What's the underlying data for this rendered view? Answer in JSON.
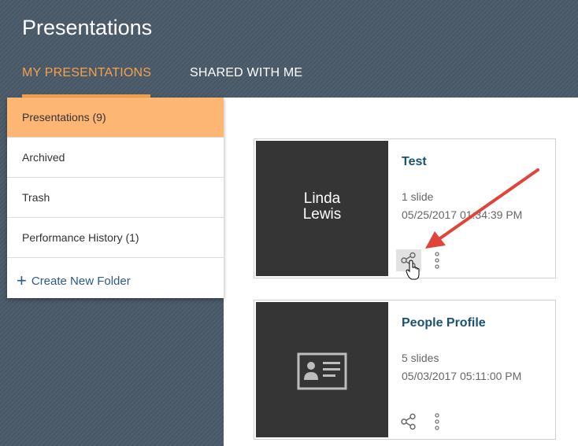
{
  "header": {
    "title": "Presentations"
  },
  "tabs": [
    {
      "label": "MY PRESENTATIONS",
      "active": true
    },
    {
      "label": "SHARED WITH ME",
      "active": false
    }
  ],
  "sidebar": {
    "items": [
      {
        "label": "Presentations (9)",
        "active": true
      },
      {
        "label": "Archived"
      },
      {
        "label": "Trash"
      },
      {
        "label": "Performance History (1)"
      }
    ],
    "create_folder": {
      "icon": "+",
      "label": "Create New Folder"
    }
  },
  "cards": [
    {
      "thumbnail_text_line1": "Linda",
      "thumbnail_text_line2": "Lewis",
      "title": "Test",
      "slides": "1 slide",
      "date": "05/25/2017 01:34:39 PM"
    },
    {
      "thumbnail_icon": "id-card-icon",
      "title": "People Profile",
      "slides": "5 slides",
      "date": "05/03/2017 05:11:00 PM"
    }
  ],
  "colors": {
    "accent": "#f5a24b",
    "active_item": "#fdb674",
    "title_blue": "#1a5276",
    "arrow": "#e0443a"
  }
}
